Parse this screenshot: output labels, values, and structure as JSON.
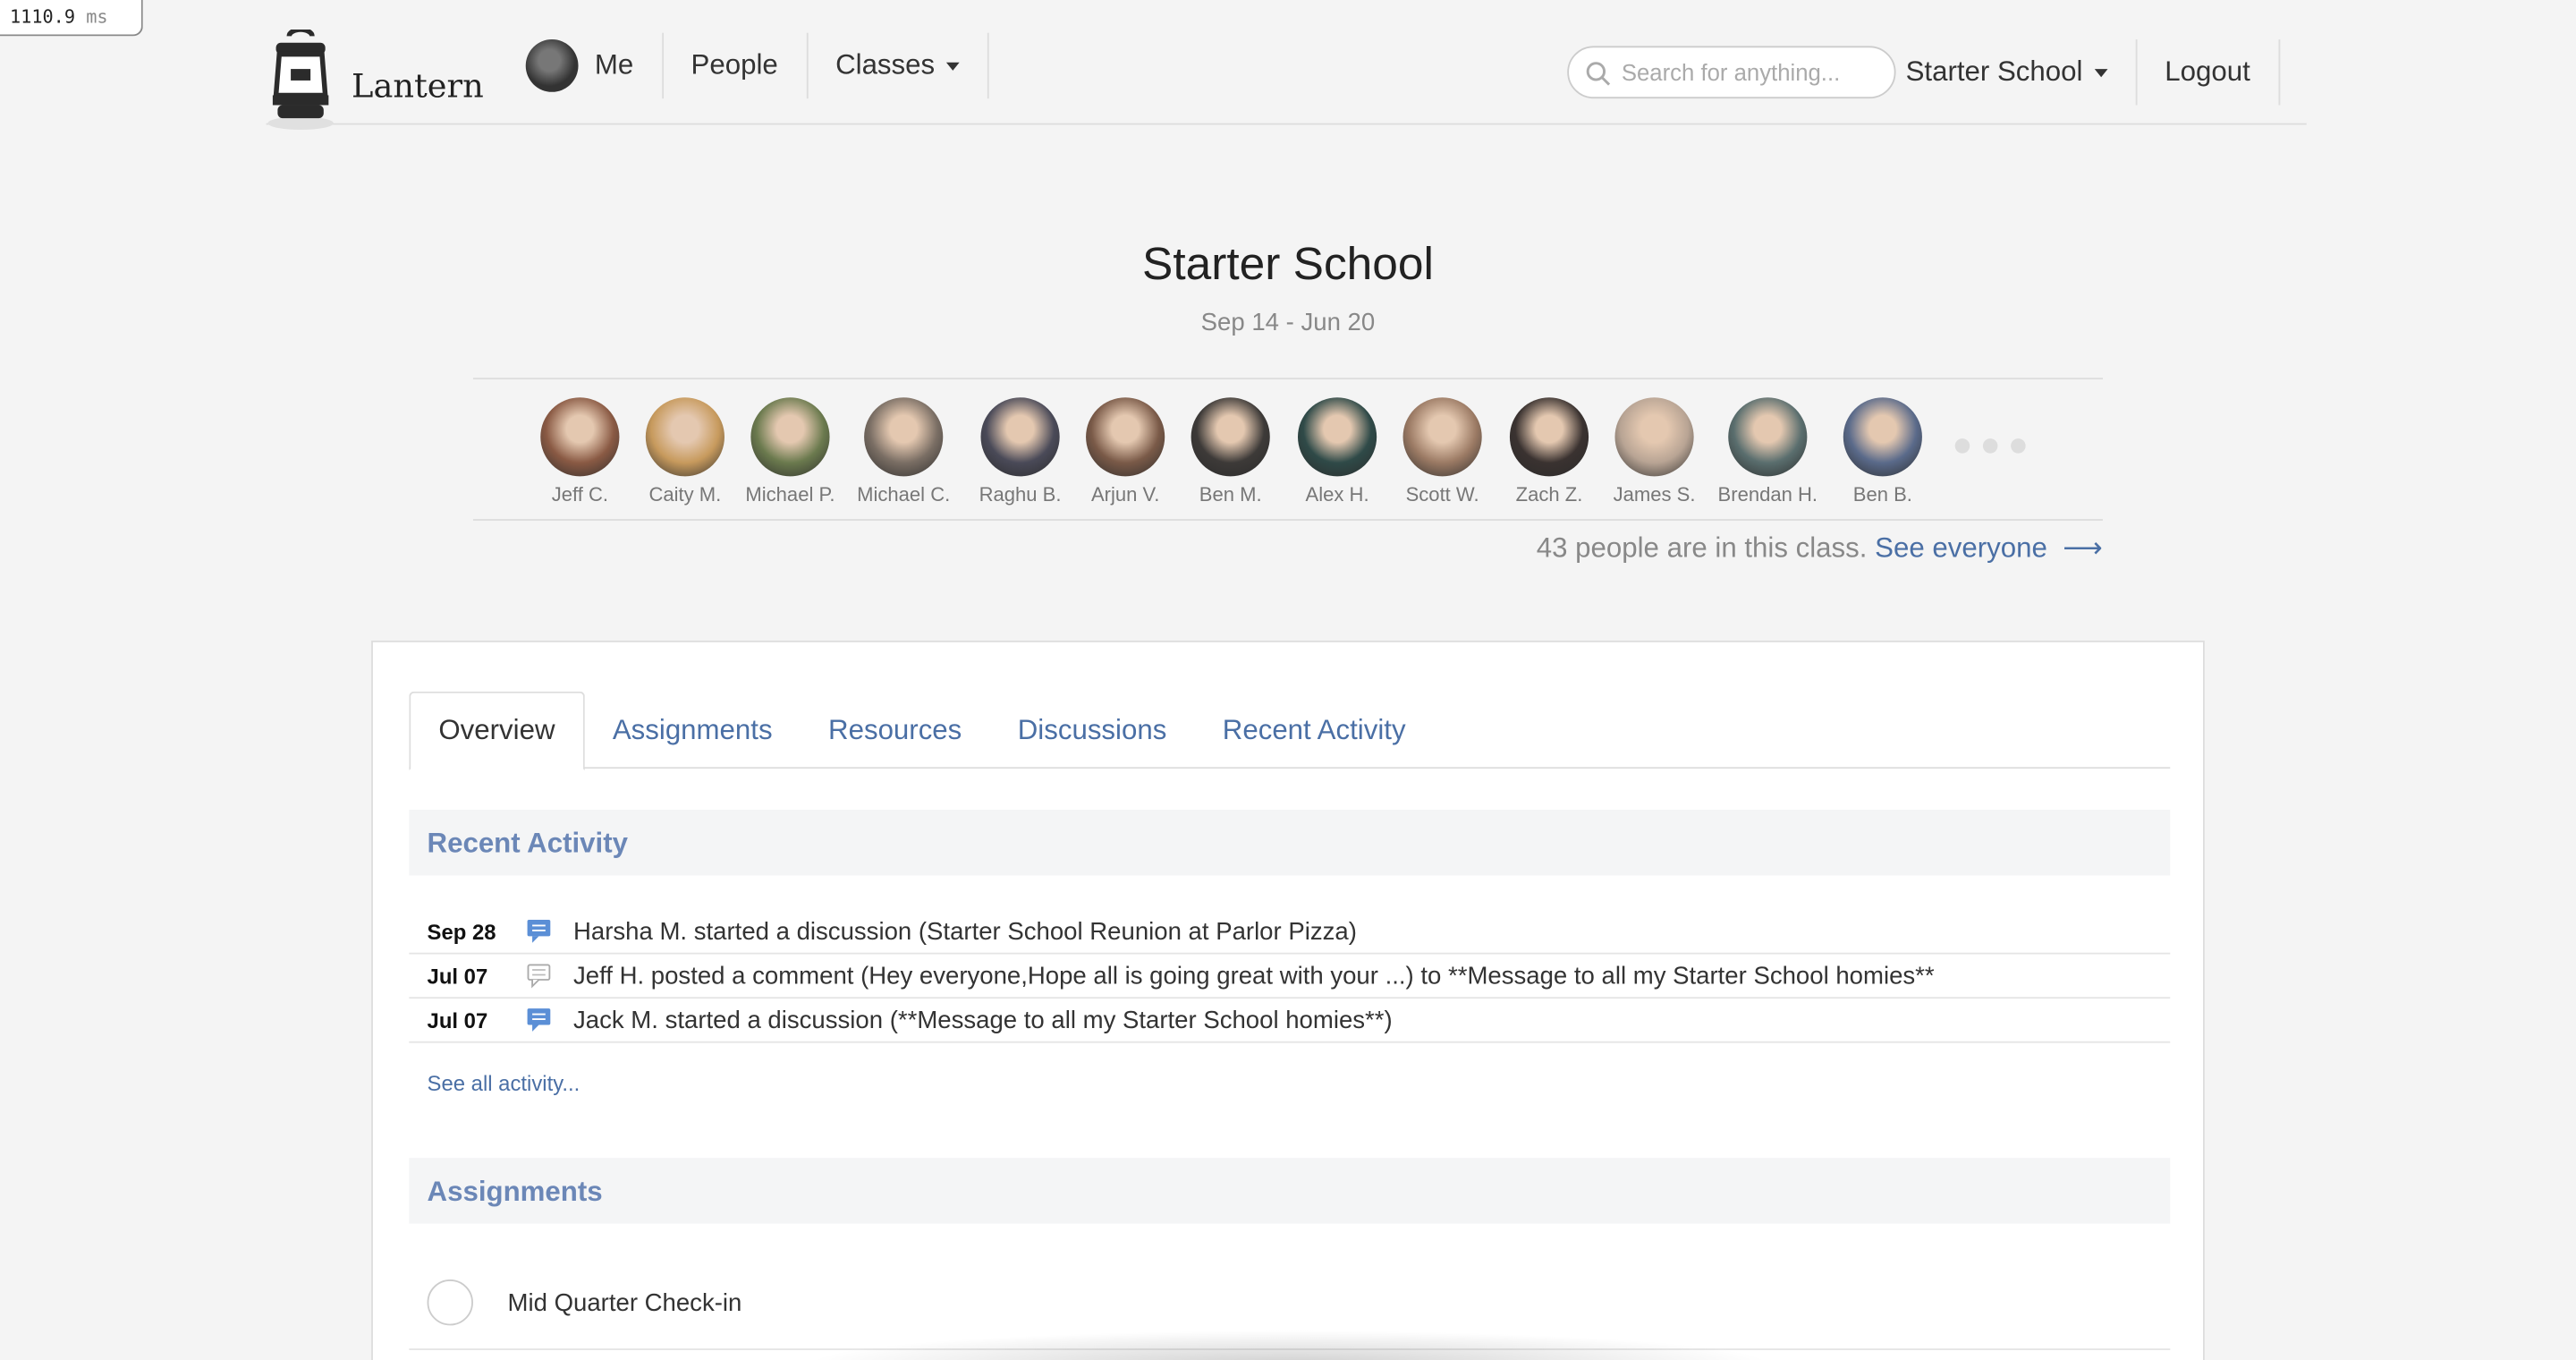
{
  "timer": {
    "value": "1110.9",
    "unit": "ms"
  },
  "header": {
    "logo_text": "Lantern",
    "nav": {
      "me": "Me",
      "people": "People",
      "classes": "Classes"
    },
    "search_placeholder": "Search for anything...",
    "school": "Starter School",
    "logout": "Logout"
  },
  "class_info": {
    "title": "Starter School",
    "dates": "Sep 14 - Jun 20",
    "people": [
      {
        "name": "Jeff C.",
        "color": "#8a5a44"
      },
      {
        "name": "Caity M.",
        "color": "#c79a5d"
      },
      {
        "name": "Michael P.",
        "color": "#6b7a4e"
      },
      {
        "name": "Michael C.",
        "color": "#7a6e64"
      },
      {
        "name": "Raghu B.",
        "color": "#4a4a58"
      },
      {
        "name": "Arjun V.",
        "color": "#7a5a48"
      },
      {
        "name": "Ben M.",
        "color": "#3d3a38"
      },
      {
        "name": "Alex H.",
        "color": "#2f4a48"
      },
      {
        "name": "Scott W.",
        "color": "#9b7a64"
      },
      {
        "name": "Zach Z.",
        "color": "#3a3230"
      },
      {
        "name": "James S.",
        "color": "#b8a494"
      },
      {
        "name": "Brendan H.",
        "color": "#5a6e6e"
      },
      {
        "name": "Ben B.",
        "color": "#5a6a8a"
      }
    ],
    "count_text": "43 people are in this class.",
    "see_everyone": "See everyone",
    "arrow": "⟶"
  },
  "tabs": [
    "Overview",
    "Assignments",
    "Resources",
    "Discussions",
    "Recent Activity"
  ],
  "recent_activity": {
    "heading": "Recent Activity",
    "items": [
      {
        "date": "Sep 28",
        "icon": "discussion-icon",
        "text": "Harsha M. started a discussion (Starter School Reunion at Parlor Pizza)"
      },
      {
        "date": "Jul 07",
        "icon": "comment-icon",
        "text": "Jeff H. posted a comment (Hey everyone,Hope all is going great with your ...) to **Message to all my Starter School homies**"
      },
      {
        "date": "Jul 07",
        "icon": "discussion-icon",
        "text": "Jack M. started a discussion (**Message to all my Starter School homies**)"
      }
    ],
    "see_all": "See all activity..."
  },
  "assignments": {
    "heading": "Assignments",
    "items": [
      {
        "label": "Mid Quarter Check-in"
      }
    ]
  },
  "colors": {
    "link": "#4a6fa5",
    "section_heading": "#6b87b7",
    "background": "#f4f4f4"
  }
}
